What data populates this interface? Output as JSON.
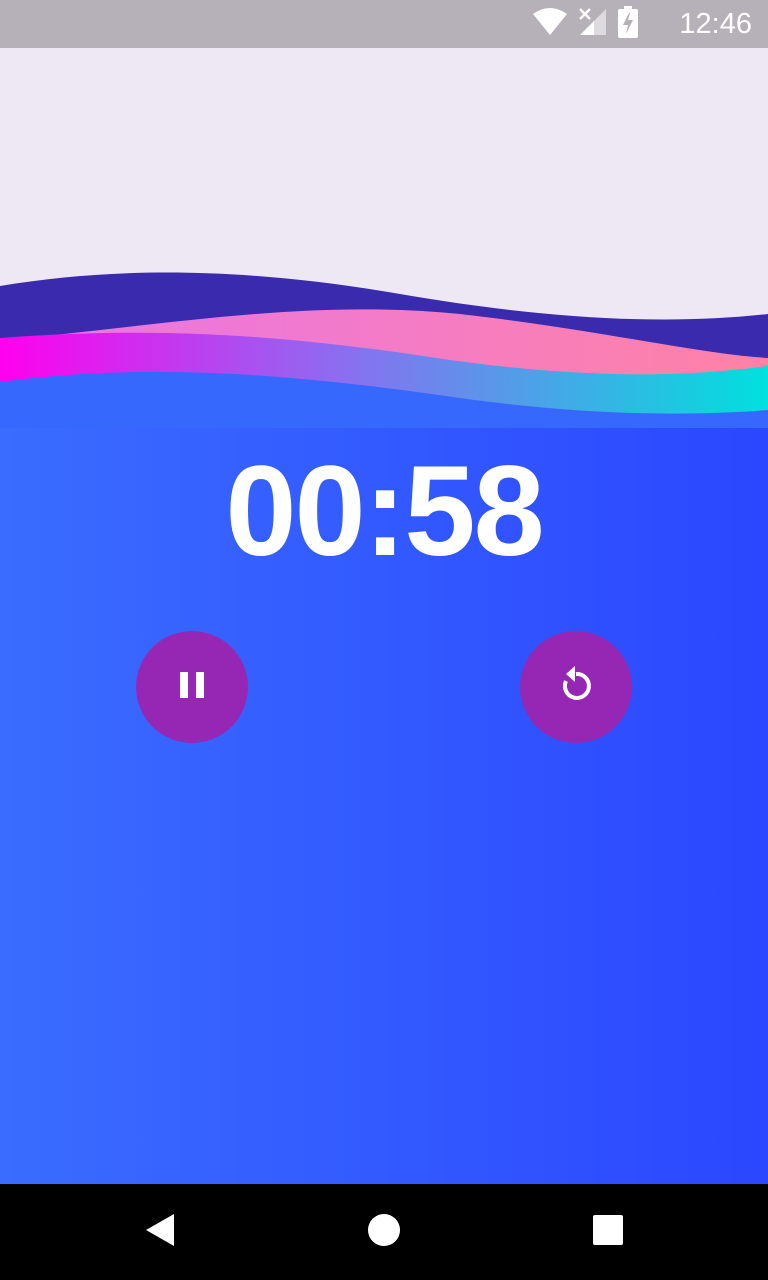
{
  "status_bar": {
    "time": "12:46",
    "icons": [
      "wifi-icon",
      "signal-no-service-icon",
      "battery-charging-icon"
    ]
  },
  "timer": {
    "display": "00:58"
  },
  "controls": {
    "pause_icon": "pause-icon",
    "reset_icon": "replay-icon"
  },
  "navigation": {
    "icons": [
      "back-icon",
      "home-icon",
      "recents-icon"
    ]
  },
  "colors": {
    "background_gradient": [
      "#3a6cff",
      "#2b47ff"
    ],
    "top_panel": "#ede8f4",
    "wave_dark": "#3a2aae",
    "wave_pink": [
      "#ee77dd",
      "#ff82a8"
    ],
    "wave_accent": [
      "#ff00ee",
      "#00e0dd"
    ],
    "button": "#9527b4",
    "status_bar": "#b6b0b8",
    "nav_bar": "#000000"
  }
}
